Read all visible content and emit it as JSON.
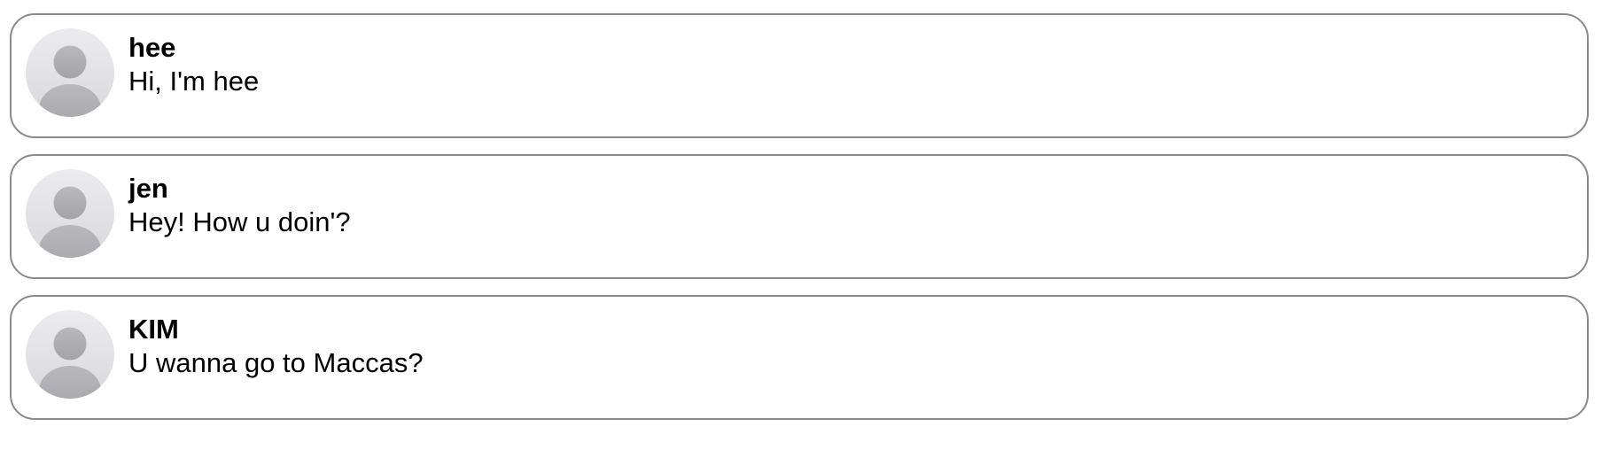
{
  "theme": {
    "card_border": "#8a8a8a",
    "avatar_bg": "#e4e4e6",
    "avatar_figure": "#aeaeb2",
    "text": "#000000"
  },
  "conversations": [
    {
      "name": "hee",
      "message": "Hi, I'm hee",
      "avatar_icon": "default-user-avatar-icon"
    },
    {
      "name": "jen",
      "message": "Hey! How u doin'?",
      "avatar_icon": "default-user-avatar-icon"
    },
    {
      "name": "KIM",
      "message": "U wanna go to Maccas?",
      "avatar_icon": "default-user-avatar-icon"
    }
  ]
}
